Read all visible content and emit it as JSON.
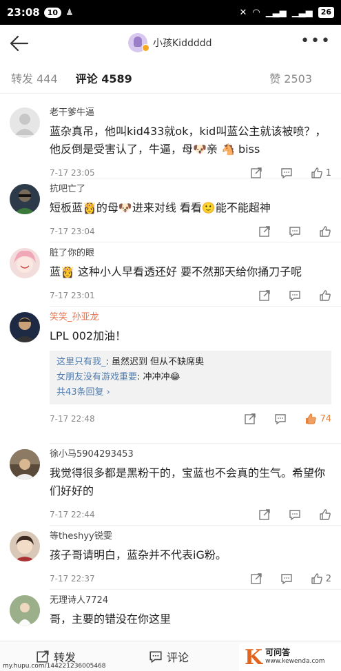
{
  "status": {
    "time": "23:08",
    "notif_count": "10",
    "battery": "26"
  },
  "header": {
    "title": "小孩Kiddddd"
  },
  "tabs": {
    "repost": "转发 444",
    "comments": "评论 4589",
    "likes": "赞 2503"
  },
  "comments": [
    {
      "name": "老干爹牛逼",
      "text": "蓝杂真吊，他叫kid433就ok，kid叫蓝公主就该被喷？，他反倒是受害认了，牛逼，母🐶亲 🐴 biss",
      "time": "7-17 23:05",
      "likes": "1"
    },
    {
      "name": "抗吧亡了",
      "text": "短板蓝👸的母🐶进来对线 看看🙂能不能超神",
      "time": "7-17 23:04",
      "likes": ""
    },
    {
      "name": "脏了你的眼",
      "text": "蓝👸 这种小人早看透还好 要不然那天给你捅刀子呢",
      "time": "7-17 23:01",
      "likes": ""
    },
    {
      "name": "笑笑_孙亚龙",
      "text": "LPL 002加油！",
      "time": "7-17 22:48",
      "likes": "74",
      "replies": [
        {
          "name": "这里只有我_",
          "text": ": 虽然迟到 但从不缺席奥"
        },
        {
          "name": "女朋友没有游戏重要",
          "text": ": 冲冲冲😂"
        }
      ],
      "more_replies": "共43条回复 ›"
    },
    {
      "name": "徐小马5904293453",
      "text": "我觉得很多都是黑粉干的，宝蓝也不会真的生气。希望你们好好的",
      "time": "7-17 22:44",
      "likes": ""
    },
    {
      "name": "等theshyy锐雯",
      "text": "孩子哥请明白，蓝杂并不代表iG粉。",
      "time": "7-17 22:37",
      "likes": "2"
    },
    {
      "name": "无理诗人7724",
      "text": "哥，主要的错没在你这里",
      "time": "",
      "likes": ""
    }
  ],
  "bottom": {
    "repost": "转发",
    "comment": "评论"
  },
  "watermark": {
    "left": "my.hupu.com/144221236005468",
    "brand_cn": "可问答",
    "brand_url": "www.kewenda.com",
    "k": "K"
  },
  "colors": {
    "orange": "#eb7350",
    "link": "#507daf",
    "hot": "#e5823b"
  }
}
